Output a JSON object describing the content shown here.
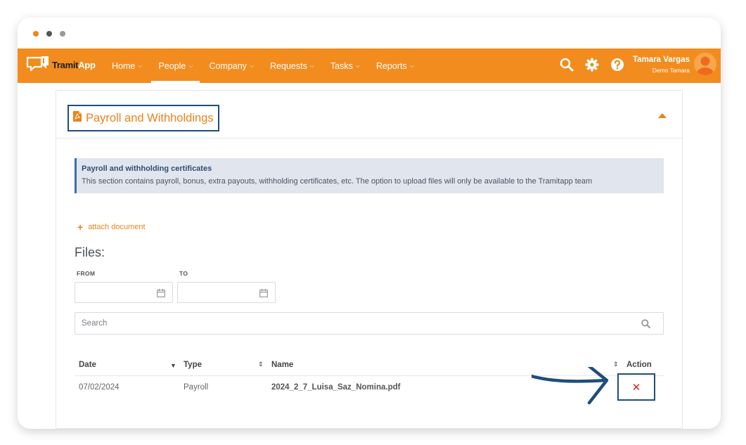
{
  "app": {
    "logo_part1": "Tramit",
    "logo_part2": "App"
  },
  "nav": {
    "items": [
      {
        "label": "Home",
        "active": false
      },
      {
        "label": "People",
        "active": true
      },
      {
        "label": "Company",
        "active": false
      },
      {
        "label": "Requests",
        "active": false
      },
      {
        "label": "Tasks",
        "active": false
      },
      {
        "label": "Reports",
        "active": false
      }
    ],
    "icons": [
      "search-icon",
      "gear-icon",
      "help-icon"
    ]
  },
  "user": {
    "name": "Tamara Vargas",
    "company": "Demo Tamara"
  },
  "panel": {
    "title": "Payroll and Withholdings",
    "info_title": "Payroll and withholding certificates",
    "info_body": "This section contains payroll, bonus, extra payouts, withholding certificates, etc. The option to upload files will only be available to the Tramitapp team",
    "attach_label": "attach document",
    "files_heading": "Files:",
    "from_label": "FROM",
    "to_label": "TO",
    "search_placeholder": "Search"
  },
  "table": {
    "headers": {
      "date": "Date",
      "type": "Type",
      "name": "Name",
      "action": "Action"
    },
    "rows": [
      {
        "date": "07/02/2024",
        "type": "Payroll",
        "name": "2024_2_7_Luisa_Saz_Nomina.pdf",
        "action": "✕"
      }
    ]
  },
  "colors": {
    "brand": "#f28c1e",
    "accent": "#e8831c",
    "highlight": "#1f4e79",
    "delete": "#e02020"
  }
}
